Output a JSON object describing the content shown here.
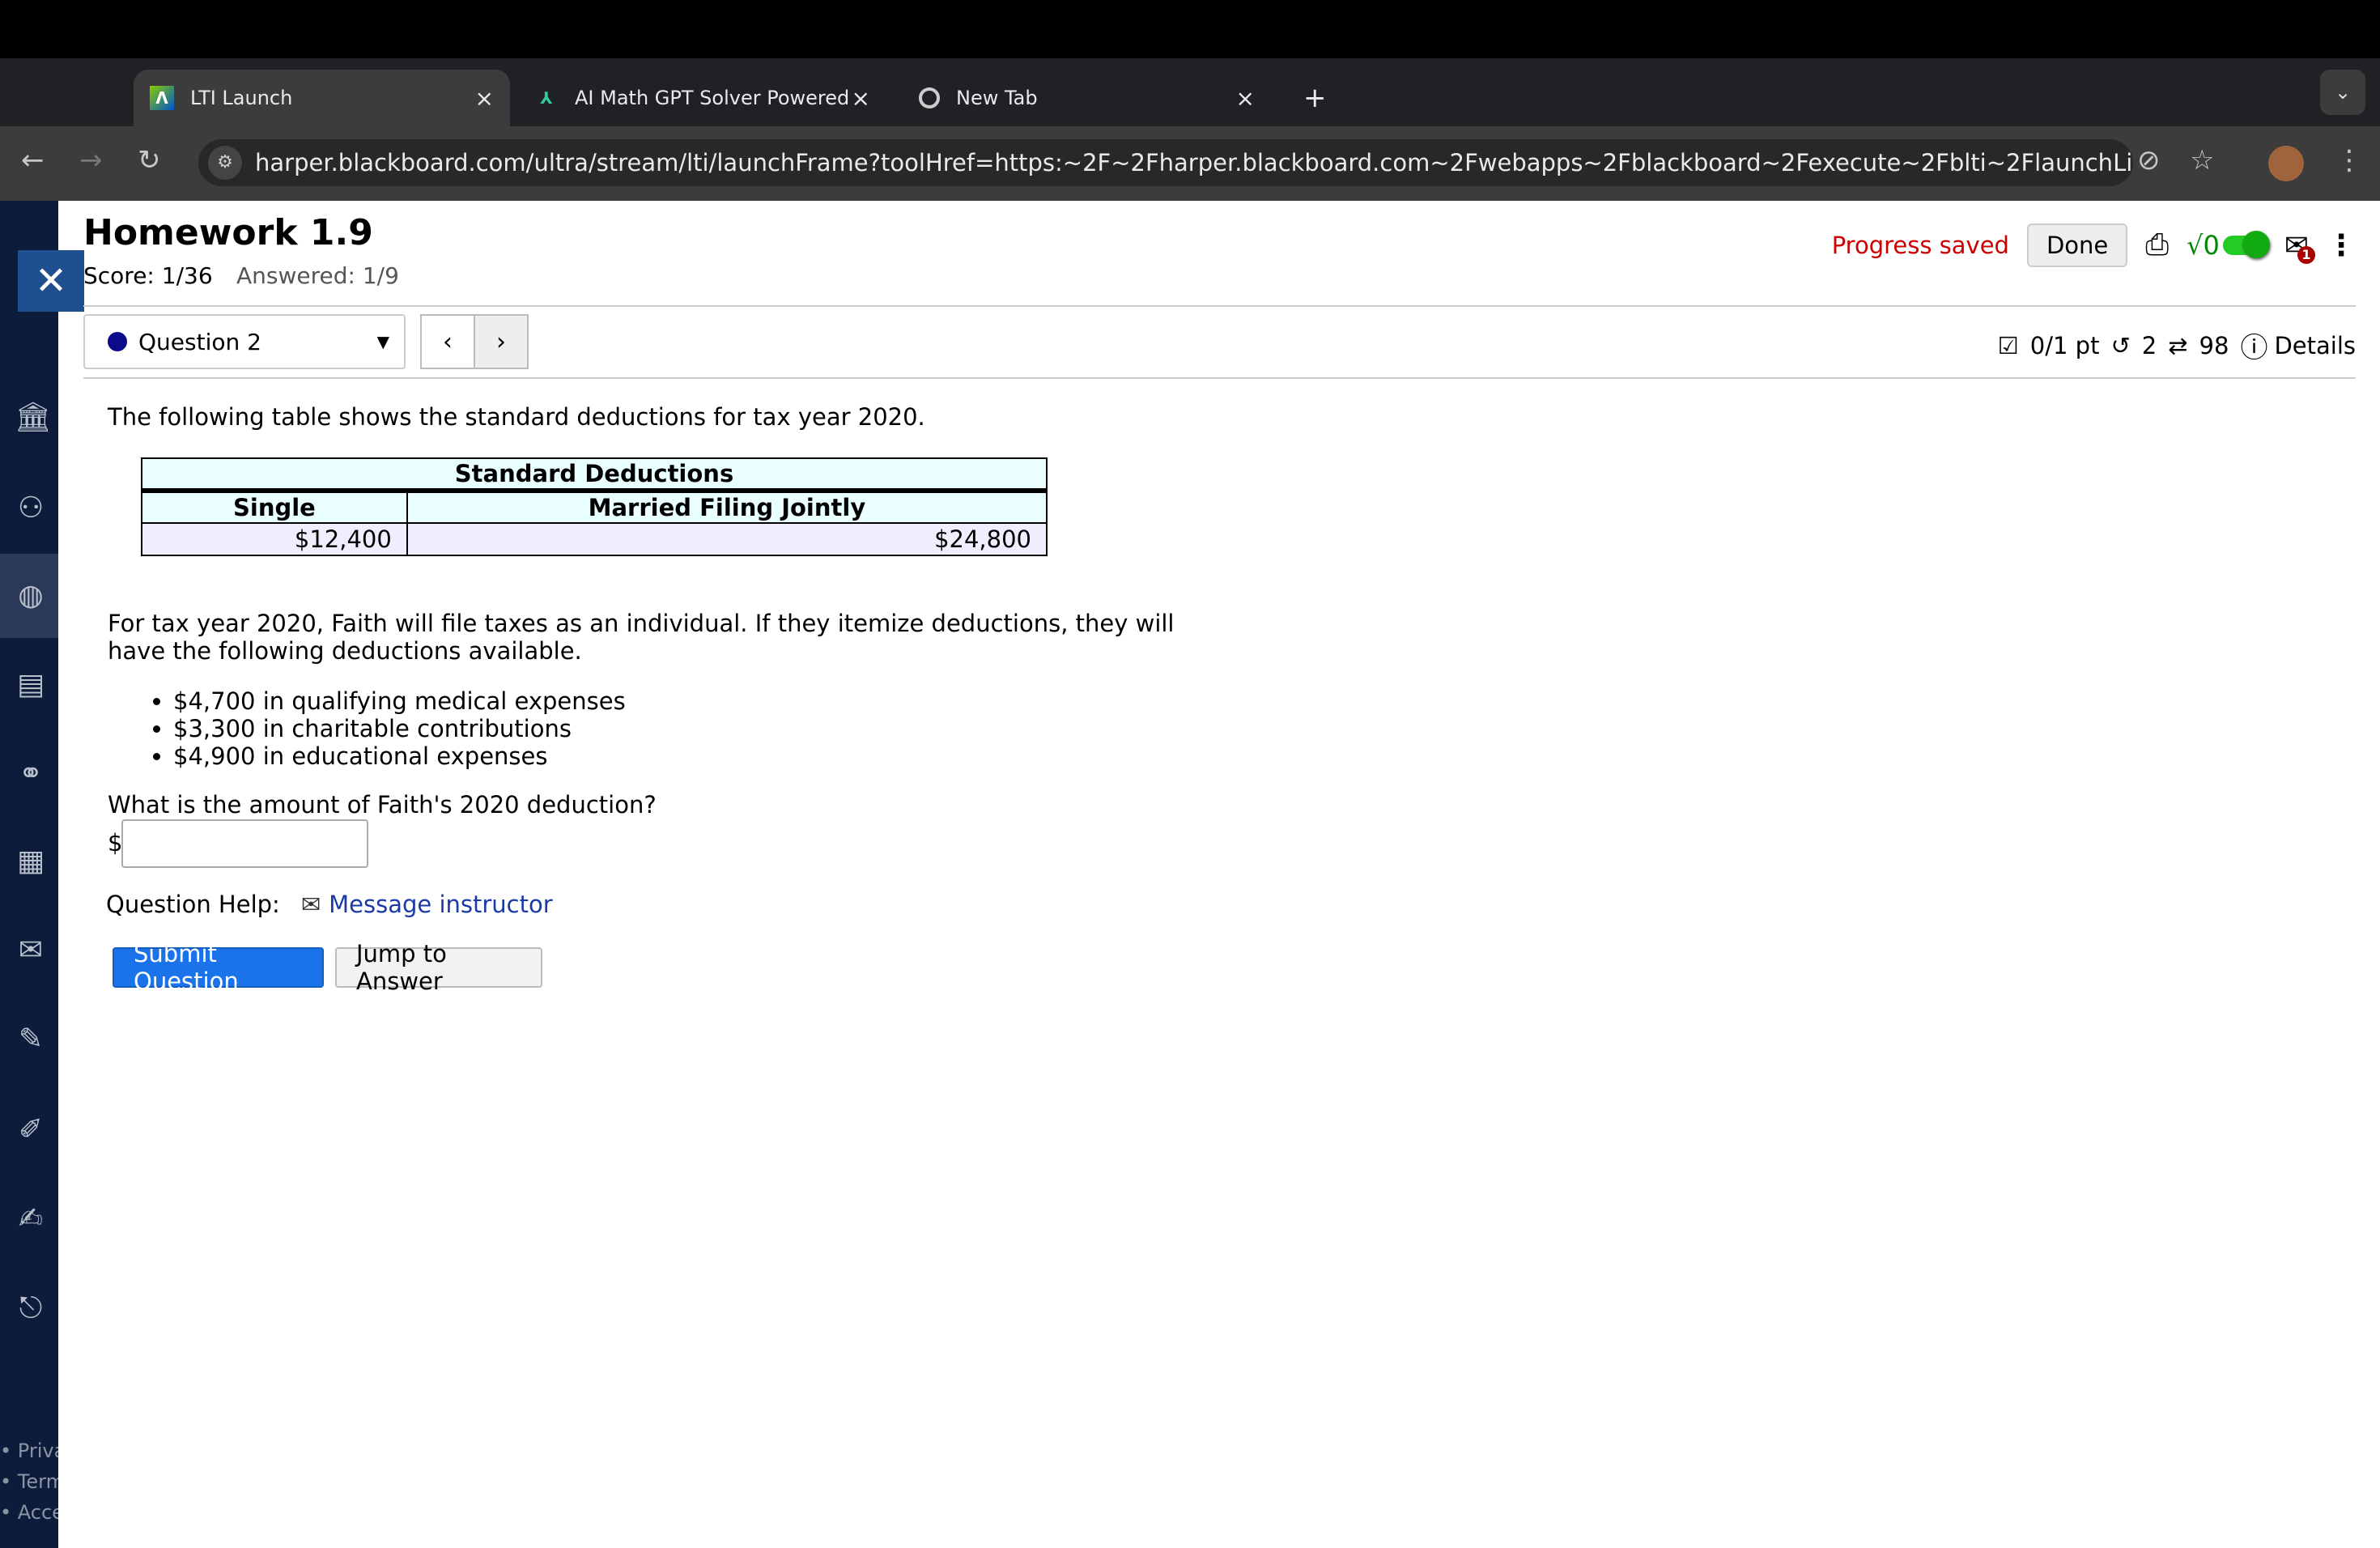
{
  "browser": {
    "tabs": [
      {
        "label": "LTI Launch",
        "icon": "anthology-icon"
      },
      {
        "label": "AI Math GPT Solver Powered",
        "icon": "compass-icon"
      },
      {
        "label": "New Tab",
        "icon": "chrome-icon"
      }
    ],
    "url": "harper.blackboard.com/ultra/stream/lti/launchFrame?toolHref=https:~2F~2Fharper.blackboard.com~2Fwebapps~2Fblackboard~2Fexecute~2Fblti~2FlaunchLink%3Fcourse_..."
  },
  "sidebar": {
    "footer": [
      "Priva",
      "Term",
      "Acce"
    ]
  },
  "header": {
    "title": "Homework 1.9",
    "score": "Score: 1/36",
    "answered": "Answered: 1/9",
    "progress": "Progress saved",
    "done": "Done",
    "sqrt": "√0",
    "mail_badge": "1"
  },
  "question_nav": {
    "selected": "Question 2",
    "stats": {
      "points": "0/1 pt",
      "retries": "2",
      "attempts": "98",
      "details": "Details"
    }
  },
  "question": {
    "intro": "The following table shows the standard deductions for tax year 2020.",
    "table": {
      "title": "Standard Deductions",
      "headers": [
        "Single",
        "Married Filing Jointly"
      ],
      "values": [
        "$12,400",
        "$24,800"
      ]
    },
    "paragraph": "For tax year 2020, Faith will file taxes as an individual. If they itemize deductions, they will have the following deductions available.",
    "bullets": [
      "$4,700 in qualifying medical expenses",
      "$3,300 in charitable contributions",
      "$4,900 in educational expenses"
    ],
    "prompt": "What is the amount of Faith's 2020 deduction?",
    "currency": "$",
    "answer": "",
    "help_label": "Question Help:",
    "message": "Message instructor",
    "submit": "Submit Question",
    "jump": "Jump to Answer"
  },
  "colors": {
    "accent": "#1a73e8",
    "saved": "#cc0000",
    "toggle": "#22bb22",
    "sidebar": "#0d1c3a"
  }
}
